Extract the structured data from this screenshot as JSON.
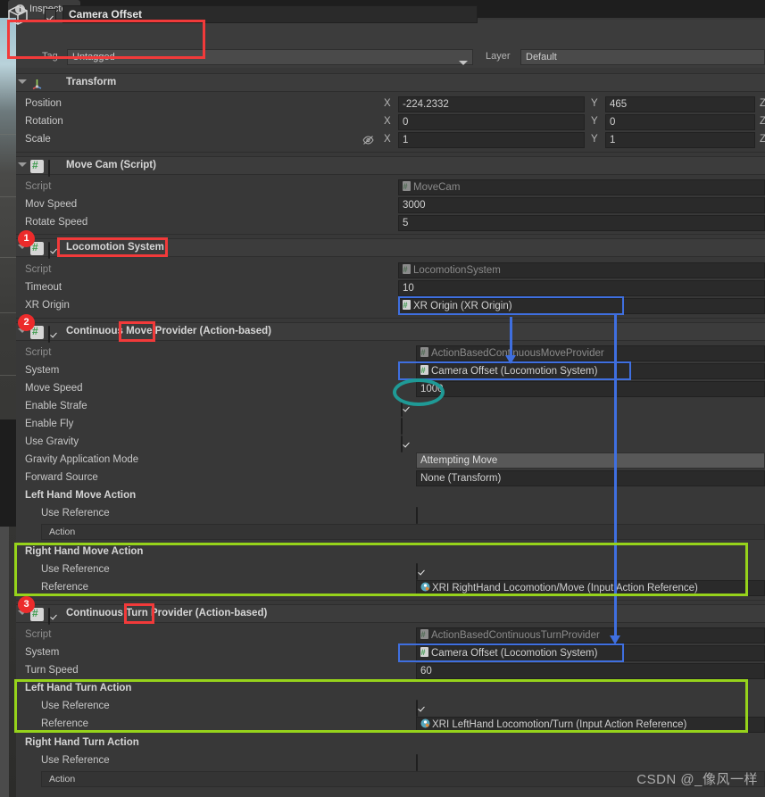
{
  "window": {
    "tab_label": "Inspector",
    "tab_icon": "info-icon"
  },
  "object_header": {
    "icon": "cube-icon",
    "enabled": true,
    "name": "Camera Offset",
    "tag_label": "Tag",
    "tag_value": "Untagged",
    "layer_label": "Layer",
    "layer_value": "Default"
  },
  "components": [
    {
      "title": "Transform",
      "icon": "transform-axis-icon",
      "has_checkbox": false,
      "rows": [
        {
          "label": "Position",
          "type": "vector3",
          "x": "-224.2332",
          "y": "465",
          "z": ""
        },
        {
          "label": "Rotation",
          "type": "vector3",
          "x": "0",
          "y": "0",
          "z": ""
        },
        {
          "label": "Scale",
          "type": "vector3",
          "x": "1",
          "y": "1",
          "z": "",
          "link_icon": "constrain-proportions-off-icon"
        }
      ]
    },
    {
      "title": "Move Cam (Script)",
      "icon": "script-icon",
      "has_checkbox": true,
      "checked": false,
      "rows": [
        {
          "label": "Script",
          "type": "object",
          "value": "MoveCam",
          "disabled": true
        },
        {
          "label": "Mov Speed",
          "type": "number",
          "value": "3000"
        },
        {
          "label": "Rotate Speed",
          "type": "number",
          "value": "5"
        }
      ]
    },
    {
      "title": "Locomotion System",
      "icon": "script-icon",
      "has_checkbox": true,
      "checked": true,
      "rows": [
        {
          "label": "Script",
          "type": "object",
          "value": "LocomotionSystem",
          "disabled": true
        },
        {
          "label": "Timeout",
          "type": "number",
          "value": "10"
        },
        {
          "label": "XR Origin",
          "type": "object",
          "value": "XR Origin (XR Origin)"
        }
      ]
    },
    {
      "title": "Continuous Move Provider (Action-based)",
      "icon": "script-icon",
      "has_checkbox": true,
      "checked": true,
      "rows": [
        {
          "label": "Script",
          "type": "object",
          "value": "ActionBasedContinuousMoveProvider",
          "disabled": true
        },
        {
          "label": "System",
          "type": "object",
          "value": "Camera Offset (Locomotion System)"
        },
        {
          "label": "Move Speed",
          "type": "number",
          "value": "1000"
        },
        {
          "label": "Enable Strafe",
          "type": "checkbox",
          "checked": true
        },
        {
          "label": "Enable Fly",
          "type": "checkbox",
          "checked": false
        },
        {
          "label": "Use Gravity",
          "type": "checkbox",
          "checked": true
        },
        {
          "label": "Gravity Application Mode",
          "type": "popup",
          "value": "Attempting Move"
        },
        {
          "label": "Forward Source",
          "type": "object",
          "value": "None (Transform)"
        },
        {
          "label": "Left Hand Move Action",
          "type": "group"
        },
        {
          "label": "Use Reference",
          "type": "checkbox-indent",
          "checked": false
        },
        {
          "label": "Action",
          "type": "inset"
        },
        {
          "label": "Right Hand Move Action",
          "type": "group"
        },
        {
          "label": "Use Reference",
          "type": "checkbox-indent",
          "checked": true
        },
        {
          "label": "Reference",
          "type": "object-indent",
          "value": "XRI RightHand Locomotion/Move (Input Action Reference)"
        }
      ]
    },
    {
      "title": "Continuous Turn Provider (Action-based)",
      "icon": "script-icon",
      "has_checkbox": true,
      "checked": true,
      "rows": [
        {
          "label": "Script",
          "type": "object",
          "value": "ActionBasedContinuousTurnProvider",
          "disabled": true
        },
        {
          "label": "System",
          "type": "object",
          "value": "Camera Offset (Locomotion System)"
        },
        {
          "label": "Turn Speed",
          "type": "number",
          "value": "60"
        },
        {
          "label": "Left Hand Turn Action",
          "type": "group"
        },
        {
          "label": "Use Reference",
          "type": "checkbox-indent",
          "checked": true
        },
        {
          "label": "Reference",
          "type": "object-indent",
          "value": "XRI LeftHand Locomotion/Turn (Input Action Reference)"
        },
        {
          "label": "Right Hand Turn Action",
          "type": "group"
        },
        {
          "label": "Use Reference",
          "type": "checkbox-indent",
          "checked": false
        },
        {
          "label": "Action",
          "type": "inset"
        }
      ]
    }
  ],
  "axis_labels": {
    "x": "X",
    "y": "Y",
    "z": "Z"
  },
  "annotations": {
    "badge_1": "1",
    "badge_2": "2",
    "badge_3": "3",
    "colors": {
      "red": "#f23a3a",
      "blue": "#3f6fe0",
      "green": "#96d31b",
      "teal": "#1f9a96"
    }
  },
  "watermark": "CSDN @_像风一样"
}
